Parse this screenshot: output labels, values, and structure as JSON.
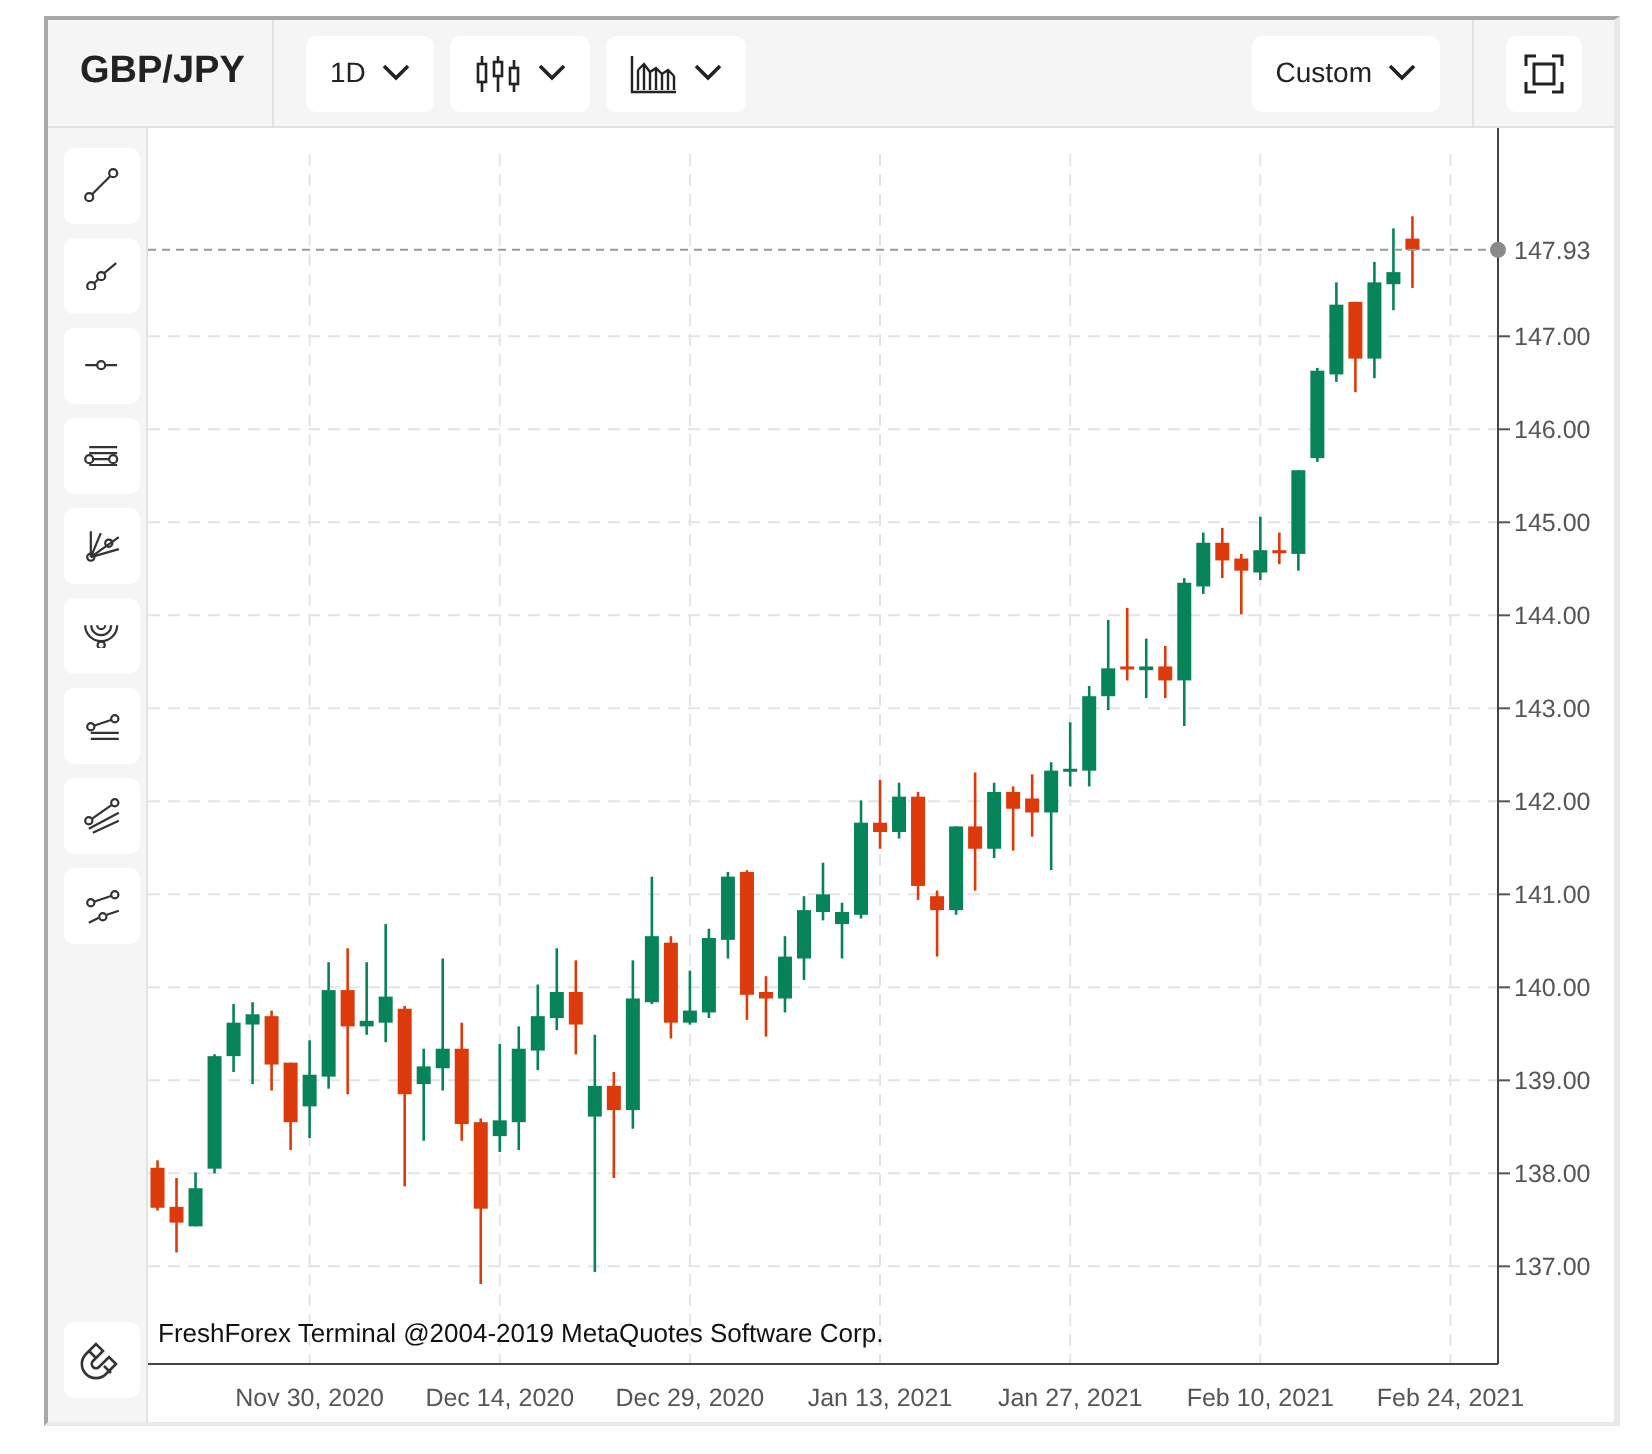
{
  "toolbar": {
    "symbol": "GBP/JPY",
    "timeframe": "1D",
    "range": "Custom"
  },
  "chart": {
    "copyright": "FreshForex Terminal @2004-2019 MetaQuotes Software Corp.",
    "chart_data": {
      "type": "candlestick",
      "grid": true,
      "ylim": [
        135.95,
        148.96
      ],
      "categories": [
        null,
        null,
        null,
        null,
        null,
        null,
        null,
        null,
        "Nov 30, 2020",
        null,
        null,
        null,
        null,
        null,
        null,
        null,
        null,
        null,
        "Dec 14, 2020",
        null,
        null,
        null,
        null,
        null,
        null,
        null,
        null,
        null,
        "Dec 29, 2020",
        null,
        null,
        null,
        null,
        null,
        null,
        null,
        null,
        null,
        "Jan 13, 2021",
        null,
        null,
        null,
        null,
        null,
        null,
        null,
        null,
        null,
        "Jan 27, 2021",
        null,
        null,
        null,
        null,
        null,
        null,
        null,
        null,
        null,
        "Feb 10, 2021",
        null,
        null,
        null,
        null,
        null,
        null,
        null,
        null,
        null,
        "Feb 24, 2021",
        null,
        null
      ],
      "ref_lines": [
        {
          "axis": "y",
          "value": 147.93,
          "label": "147.93"
        }
      ],
      "yticks": [
        {
          "value": 137,
          "label": "137.00"
        },
        {
          "value": 138,
          "label": "138.00"
        },
        {
          "value": 139,
          "label": "139.00"
        },
        {
          "value": 140,
          "label": "140.00"
        },
        {
          "value": 141,
          "label": "141.00"
        },
        {
          "value": 142,
          "label": "142.00"
        },
        {
          "value": 143,
          "label": "143.00"
        },
        {
          "value": 144,
          "label": "144.00"
        },
        {
          "value": 145,
          "label": "145.00"
        },
        {
          "value": 146,
          "label": "146.00"
        },
        {
          "value": 147,
          "label": "147.00"
        }
      ],
      "ohlc": [
        [
          138.06,
          138.14,
          137.6,
          137.63
        ],
        [
          137.64,
          137.95,
          137.15,
          137.47
        ],
        [
          137.43,
          138.01,
          137.43,
          137.84
        ],
        [
          138.05,
          139.28,
          138.0,
          139.26
        ],
        [
          139.26,
          139.82,
          139.09,
          139.62
        ],
        [
          139.6,
          139.84,
          138.96,
          139.71
        ],
        [
          139.69,
          139.75,
          138.89,
          139.17
        ],
        [
          139.19,
          139.19,
          138.25,
          138.55
        ],
        [
          138.72,
          139.43,
          138.38,
          139.06
        ],
        [
          139.04,
          140.27,
          138.91,
          139.97
        ],
        [
          139.97,
          140.42,
          138.85,
          139.58
        ],
        [
          139.58,
          140.27,
          139.49,
          139.64
        ],
        [
          139.62,
          140.68,
          139.41,
          139.9
        ],
        [
          139.77,
          139.8,
          137.86,
          138.85
        ],
        [
          138.96,
          139.34,
          138.35,
          139.15
        ],
        [
          139.13,
          140.31,
          138.89,
          139.34
        ],
        [
          139.34,
          139.62,
          138.35,
          138.53
        ],
        [
          138.55,
          138.59,
          136.81,
          137.62
        ],
        [
          138.4,
          139.39,
          138.23,
          138.57
        ],
        [
          138.55,
          139.58,
          138.25,
          139.34
        ],
        [
          139.32,
          140.03,
          139.11,
          139.69
        ],
        [
          139.67,
          140.42,
          139.54,
          139.95
        ],
        [
          139.95,
          140.29,
          139.28,
          139.6
        ],
        [
          138.61,
          139.49,
          136.94,
          138.94
        ],
        [
          138.94,
          139.09,
          137.95,
          138.68
        ],
        [
          138.68,
          140.29,
          138.48,
          139.88
        ],
        [
          139.84,
          141.19,
          139.82,
          140.55
        ],
        [
          140.48,
          140.55,
          139.45,
          139.62
        ],
        [
          139.62,
          140.18,
          139.6,
          139.75
        ],
        [
          139.73,
          140.63,
          139.67,
          140.53
        ],
        [
          140.51,
          141.24,
          140.31,
          141.19
        ],
        [
          141.24,
          141.26,
          139.65,
          139.92
        ],
        [
          139.95,
          140.12,
          139.47,
          139.88
        ],
        [
          139.88,
          140.55,
          139.73,
          140.33
        ],
        [
          140.31,
          140.98,
          140.08,
          140.83
        ],
        [
          140.81,
          141.34,
          140.72,
          141.0
        ],
        [
          140.68,
          140.91,
          140.31,
          140.81
        ],
        [
          140.78,
          142.01,
          140.74,
          141.77
        ],
        [
          141.77,
          142.23,
          141.49,
          141.67
        ],
        [
          141.67,
          142.2,
          141.6,
          142.05
        ],
        [
          142.05,
          142.1,
          140.94,
          141.09
        ],
        [
          140.98,
          141.04,
          140.33,
          140.83
        ],
        [
          140.83,
          141.73,
          140.78,
          141.73
        ],
        [
          141.73,
          142.31,
          141.04,
          141.49
        ],
        [
          141.49,
          142.2,
          141.39,
          142.1
        ],
        [
          142.1,
          142.16,
          141.47,
          141.92
        ],
        [
          142.03,
          142.29,
          141.62,
          141.88
        ],
        [
          141.88,
          142.42,
          141.26,
          142.33
        ],
        [
          142.33,
          142.85,
          142.16,
          142.35
        ],
        [
          142.33,
          143.24,
          142.16,
          143.13
        ],
        [
          143.13,
          143.95,
          142.98,
          143.43
        ],
        [
          143.45,
          144.08,
          143.3,
          143.42
        ],
        [
          143.41,
          143.75,
          143.11,
          143.45
        ],
        [
          143.45,
          143.67,
          143.11,
          143.3
        ],
        [
          143.3,
          144.4,
          142.81,
          144.35
        ],
        [
          144.31,
          144.89,
          144.23,
          144.78
        ],
        [
          144.78,
          144.94,
          144.4,
          144.59
        ],
        [
          144.61,
          144.66,
          144.01,
          144.48
        ],
        [
          144.46,
          145.06,
          144.38,
          144.7
        ],
        [
          144.7,
          144.89,
          144.55,
          144.68
        ],
        [
          144.66,
          145.56,
          144.48,
          145.56
        ],
        [
          145.69,
          146.66,
          145.65,
          146.63
        ],
        [
          146.59,
          147.58,
          146.51,
          147.34
        ],
        [
          147.37,
          147.37,
          146.4,
          146.76
        ],
        [
          146.76,
          147.8,
          146.55,
          147.58
        ],
        [
          147.56,
          148.16,
          147.28,
          147.69
        ],
        [
          148.05,
          148.29,
          147.52,
          147.93
        ],
        null,
        null,
        null,
        null
      ]
    }
  }
}
